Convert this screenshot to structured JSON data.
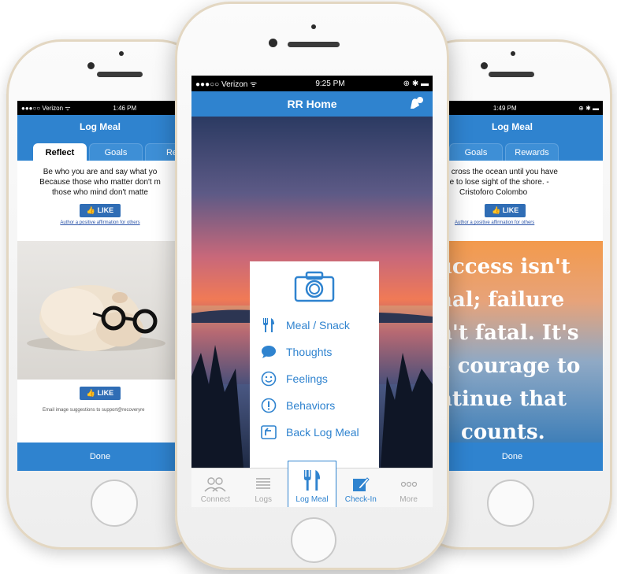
{
  "left_phone": {
    "status": {
      "carrier": "●●●○○ Verizon ᯤ",
      "time": "1:46 PM"
    },
    "title": "Log Meal",
    "tabs": [
      "Reflect",
      "Goals",
      "Re"
    ],
    "quote_lines": [
      "Be who you are and say what yo",
      "Because those who matter don't m",
      "those who mind don't matte"
    ],
    "like_label": "LIKE",
    "author_link": "Author a positive affirmation for others",
    "like_label_2": "LIKE",
    "email_text": "Email image suggestions to support@recoveryre",
    "done_label": "Done"
  },
  "right_phone": {
    "status": {
      "carrier": "ᯤ",
      "time": "1:49 PM",
      "icons": "⊕ ✱ ▬"
    },
    "title": "Log Meal",
    "tabs": [
      "ect",
      "Goals",
      "Rewards"
    ],
    "quote_lines": [
      "never cross the ocean until you have",
      "ourage to lose sight of the shore. -",
      "Cristoforo Colombo"
    ],
    "like_label": "LIKE",
    "author_link": "Author a positive affirmation for others",
    "poster_lines": [
      "uccess isn't",
      "nal; failure",
      "n't fatal. It's",
      "e courage to",
      "ntinue that",
      "counts."
    ],
    "done_label": "Done"
  },
  "center_phone": {
    "status": {
      "carrier": "●●●○○ Verizon ᯤ",
      "time": "9:25 PM",
      "icons": "⊕ ✱ ▬"
    },
    "title": "RR Home",
    "menu": {
      "items": [
        {
          "icon": "fork-knife-icon",
          "label": "Meal / Snack"
        },
        {
          "icon": "speech-bubble-icon",
          "label": "Thoughts"
        },
        {
          "icon": "smiley-icon",
          "label": "Feelings"
        },
        {
          "icon": "exclamation-icon",
          "label": "Behaviors"
        },
        {
          "icon": "back-arrow-icon",
          "label": "Back Log Meal"
        }
      ]
    },
    "tabbar": [
      {
        "icon": "people-icon",
        "label": "Connect"
      },
      {
        "icon": "list-icon",
        "label": "Logs"
      },
      {
        "icon": "fork-knife-icon",
        "label": "Log Meal"
      },
      {
        "icon": "edit-icon",
        "label": "Check-In"
      },
      {
        "icon": "more-icon",
        "label": "More"
      }
    ]
  },
  "colors": {
    "accent": "#2f83cf",
    "like": "#2f6db5",
    "frame": "#e3d7c2"
  }
}
